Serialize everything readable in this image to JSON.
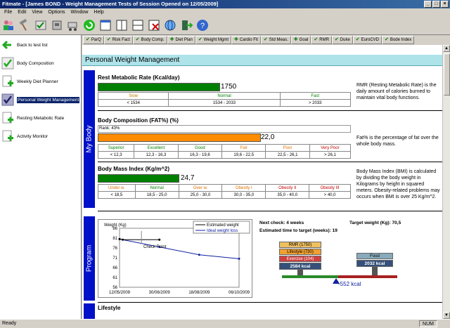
{
  "window": {
    "title": "Fitmate - [James BOND - Weight Management Tests of Session Opened on 12/05/2009]"
  },
  "menu": [
    "File",
    "Edit",
    "View",
    "Options",
    "Window",
    "Help"
  ],
  "sidebar": {
    "items": [
      {
        "label": "Back to test list"
      },
      {
        "label": "Body Composition"
      },
      {
        "label": "Weekly Diet Planner"
      },
      {
        "label": "Personal Weight Management"
      },
      {
        "label": "Resting Metabolic Rate"
      },
      {
        "label": "Activity Monitor"
      }
    ]
  },
  "tabs": [
    "ParQ",
    "Risk Fact",
    "Body Comp.",
    "Diet Plan",
    "Weight Mgmt",
    "Cardio Fit",
    "Std Meas.",
    "Goal",
    "RMR",
    "Duke",
    "EuroCVD",
    "Bode Index"
  ],
  "page": {
    "title": "Personal Weight Management"
  },
  "band_labels": {
    "body": "My Body",
    "program": "Program"
  },
  "rmr": {
    "title": "Rest Metabolic Rate (Kcal/day)",
    "value": "1750",
    "fill_fraction": 0.48,
    "color": "#008000",
    "ranges": [
      {
        "label": "Slow",
        "range": "< 1534"
      },
      {
        "label": "Normal",
        "range": "1534 - 2033"
      },
      {
        "label": "Fast",
        "range": "> 2033"
      }
    ],
    "desc": "RMR (Resting Metabolic Rate) is the daily amount of calories burned to maintain vital body functions."
  },
  "fat": {
    "title": "Body Composition (FAT%) (%)",
    "rank": "Rank: 43%",
    "value": "22,0",
    "fill_fraction": 0.64,
    "color": "#ff8c00",
    "ranges": [
      {
        "label": "Superior",
        "range": "< 12,3"
      },
      {
        "label": "Excellent",
        "range": "12,3 - 16,3"
      },
      {
        "label": "Good",
        "range": "16,3 - 19,6"
      },
      {
        "label": "Fair",
        "range": "19,6 - 22,5"
      },
      {
        "label": "Poor",
        "range": "22,5 - 26,1"
      },
      {
        "label": "Very Poor",
        "range": "> 26,1"
      }
    ],
    "desc": "Fat% is the percentage of fat over the whole body mass."
  },
  "bmi": {
    "title": "Body Mass Index (Kg/m^2)",
    "value": "24,7",
    "fill_fraction": 0.32,
    "color": "#008000",
    "ranges": [
      {
        "label": "Under w.",
        "range": "< 18,5"
      },
      {
        "label": "Normal",
        "range": "18,5 - 25,0"
      },
      {
        "label": "Over w.",
        "range": "25,0 - 30,0"
      },
      {
        "label": "Obesity I",
        "range": "30,0 - 35,0"
      },
      {
        "label": "Obesity II",
        "range": "35,0 - 40,0"
      },
      {
        "label": "Obesity III",
        "range": "> 40,0"
      }
    ],
    "desc": "Body Mass Index (BMI) is calculated by dividing the body weight in Kilograms by height in squared meters. Obesity-related problems may occurs when BMI is over 25 Kg/m^2."
  },
  "program": {
    "next_check": "Next check: 4 weeks",
    "target_weight": "Target weight (Kg): 70,5",
    "est_time": "Estimated time to target (weeks): 19",
    "balance": {
      "rmr": "RMR (1750)",
      "lifestyle": "Lifestyle (730)",
      "exercise": "Exercise (104)",
      "total": "2584 kcal",
      "food_label": "Food",
      "food": "2032 kcal",
      "diff": "-552 kcal"
    }
  },
  "lifestyle": {
    "title": "Lifestyle"
  },
  "chart_data": {
    "type": "line",
    "ylabel": "Weight (Kg)",
    "ylim": [
      56,
      86
    ],
    "yticks": [
      56,
      61,
      66,
      71,
      76,
      81,
      86
    ],
    "xticks": [
      "12/05/2009",
      "30/06/2009",
      "18/08/2009",
      "06/10/2009"
    ],
    "annotation": "Check Point",
    "series": [
      {
        "name": "Estimated weight",
        "x": [
          0,
          0.08,
          1.0,
          1.0
        ],
        "values": [
          80.5,
          80.2,
          80.2,
          80.2
        ]
      },
      {
        "name": "Ideal weight loss",
        "x": [
          0,
          1,
          2,
          3
        ],
        "values": [
          80.5,
          76.5,
          72.5,
          70.5
        ]
      }
    ]
  },
  "status": {
    "left": "Ready",
    "num": "NUM"
  }
}
